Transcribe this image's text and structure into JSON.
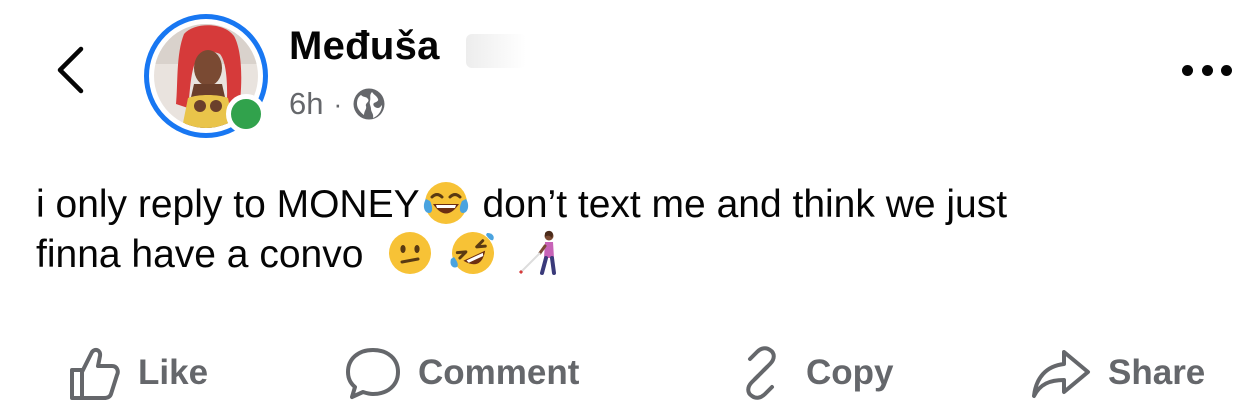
{
  "post": {
    "author_name": "Međuša",
    "time": "6h",
    "separator": "·",
    "privacy_icon": "globe-icon",
    "online": true,
    "text_line1": "i only reply to MONEY",
    "text_after_emoji1": " don’t text me and think we just",
    "text_line2": "finna have a convo",
    "emojis": [
      "face-with-tears-of-joy",
      "confused-face",
      "rolling-on-floor-laughing",
      "person-with-white-cane"
    ]
  },
  "actions": {
    "like_label": "Like",
    "comment_label": "Comment",
    "copy_label": "Copy",
    "share_label": "Share"
  },
  "colors": {
    "accent": "#1877f2",
    "online": "#31a24c",
    "secondary_text": "#65676b",
    "primary_text": "#050505"
  }
}
